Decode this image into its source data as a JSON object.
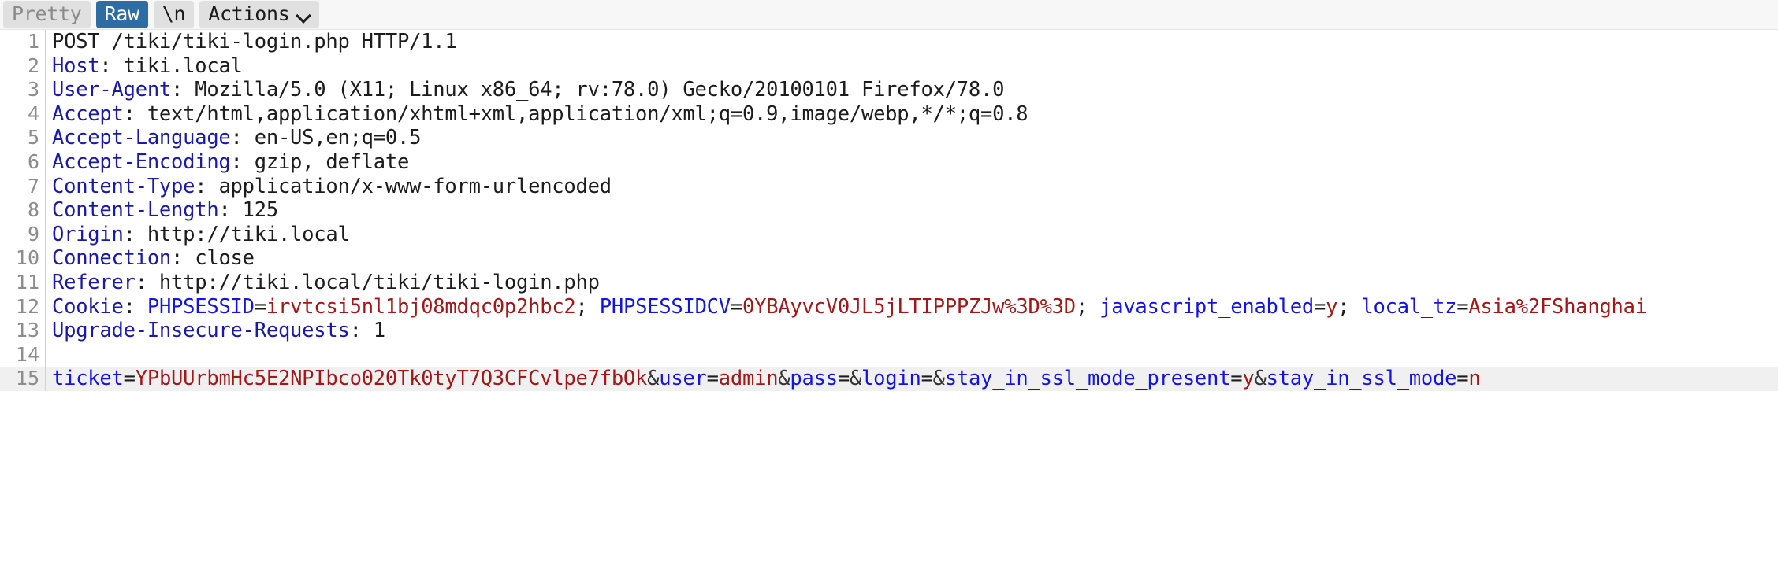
{
  "toolbar": {
    "buttons": [
      {
        "label": "Pretty",
        "state": "inactive"
      },
      {
        "label": "Raw",
        "state": "active"
      },
      {
        "label": "\\n",
        "state": "dark"
      },
      {
        "label": "Actions",
        "state": "dark",
        "icon": "chevron-down-icon"
      }
    ],
    "pretty_label": "Pretty",
    "raw_label": "Raw",
    "newline_label": "\\n",
    "actions_label": "Actions"
  },
  "editor": {
    "highlighted_line": 15,
    "lines": [
      {
        "num": "1",
        "tokens": [
          {
            "t": "POST /tiki/tiki-login.php HTTP/1.1",
            "c": "v"
          }
        ]
      },
      {
        "num": "2",
        "tokens": [
          {
            "t": "Host",
            "c": "k"
          },
          {
            "t": ": tiki.local",
            "c": "v"
          }
        ]
      },
      {
        "num": "3",
        "tokens": [
          {
            "t": "User-Agent",
            "c": "k"
          },
          {
            "t": ": Mozilla/5.0 (X11; Linux x86_64; rv:78.0) Gecko/20100101 Firefox/78.0",
            "c": "v"
          }
        ]
      },
      {
        "num": "4",
        "tokens": [
          {
            "t": "Accept",
            "c": "k"
          },
          {
            "t": ": text/html,application/xhtml+xml,application/xml;q=0.9,image/webp,*/*;q=0.8",
            "c": "v"
          }
        ]
      },
      {
        "num": "5",
        "tokens": [
          {
            "t": "Accept-Language",
            "c": "k"
          },
          {
            "t": ": en-US,en;q=0.5",
            "c": "v"
          }
        ]
      },
      {
        "num": "6",
        "tokens": [
          {
            "t": "Accept-Encoding",
            "c": "k"
          },
          {
            "t": ": gzip, deflate",
            "c": "v"
          }
        ]
      },
      {
        "num": "7",
        "tokens": [
          {
            "t": "Content-Type",
            "c": "k"
          },
          {
            "t": ": application/x-www-form-urlencoded",
            "c": "v"
          }
        ]
      },
      {
        "num": "8",
        "tokens": [
          {
            "t": "Content-Length",
            "c": "k"
          },
          {
            "t": ": 125",
            "c": "v"
          }
        ]
      },
      {
        "num": "9",
        "tokens": [
          {
            "t": "Origin",
            "c": "k"
          },
          {
            "t": ": http://tiki.local",
            "c": "v"
          }
        ]
      },
      {
        "num": "10",
        "tokens": [
          {
            "t": "Connection",
            "c": "k"
          },
          {
            "t": ": close",
            "c": "v"
          }
        ]
      },
      {
        "num": "11",
        "tokens": [
          {
            "t": "Referer",
            "c": "k"
          },
          {
            "t": ": http://tiki.local/tiki/tiki-login.php",
            "c": "v"
          }
        ]
      },
      {
        "num": "12",
        "tokens": [
          {
            "t": "Cookie",
            "c": "k"
          },
          {
            "t": ": ",
            "c": "v"
          },
          {
            "t": "PHPSESSID",
            "c": "kb"
          },
          {
            "t": "=",
            "c": "v"
          },
          {
            "t": "irvtcsi5nl1bj08mdqc0p2hbc2",
            "c": "r"
          },
          {
            "t": "; ",
            "c": "v"
          },
          {
            "t": "PHPSESSIDCV",
            "c": "kb"
          },
          {
            "t": "=",
            "c": "v"
          },
          {
            "t": "0YBAyvcV0JL5jLTIPPPZJw%3D%3D",
            "c": "r"
          },
          {
            "t": "; ",
            "c": "v"
          },
          {
            "t": "javascript_enabled",
            "c": "kb"
          },
          {
            "t": "=",
            "c": "v"
          },
          {
            "t": "y",
            "c": "r"
          },
          {
            "t": "; ",
            "c": "v"
          },
          {
            "t": "local_tz",
            "c": "kb"
          },
          {
            "t": "=",
            "c": "v"
          },
          {
            "t": "Asia%2FShanghai",
            "c": "r"
          }
        ]
      },
      {
        "num": "13",
        "tokens": [
          {
            "t": "Upgrade-Insecure-Requests",
            "c": "k"
          },
          {
            "t": ": 1",
            "c": "v"
          }
        ]
      },
      {
        "num": "14",
        "tokens": []
      },
      {
        "num": "15",
        "highlight": true,
        "tokens": [
          {
            "t": "ticket",
            "c": "kb"
          },
          {
            "t": "=",
            "c": "v"
          },
          {
            "t": "YPbUUrbmHc5E2NPIbco020Tk0tyT7Q3CFCvlpe7fbOk",
            "c": "r"
          },
          {
            "t": "&",
            "c": "amp"
          },
          {
            "t": "user",
            "c": "kb"
          },
          {
            "t": "=",
            "c": "v"
          },
          {
            "t": "admin",
            "c": "r"
          },
          {
            "t": "&",
            "c": "amp"
          },
          {
            "t": "pass",
            "c": "kb"
          },
          {
            "t": "=",
            "c": "v"
          },
          {
            "t": "&",
            "c": "amp"
          },
          {
            "t": "login",
            "c": "kb"
          },
          {
            "t": "=",
            "c": "v"
          },
          {
            "t": "&",
            "c": "amp"
          },
          {
            "t": "stay_in_ssl_mode_present",
            "c": "kb"
          },
          {
            "t": "=",
            "c": "v"
          },
          {
            "t": "y",
            "c": "r"
          },
          {
            "t": "&",
            "c": "amp"
          },
          {
            "t": "stay_in_ssl_mode",
            "c": "kb"
          },
          {
            "t": "=",
            "c": "v"
          },
          {
            "t": "n",
            "c": "r"
          }
        ]
      }
    ]
  },
  "colors": {
    "accent": "#2e6da4",
    "header_name": "#1a1aa8",
    "param_name": "#1414e0",
    "value": "#a01818",
    "text": "#1c1c1c",
    "gutter": "#8d8d8d",
    "highlight_bg": "#f0f0f0",
    "toolbar_bg": "#f7f7f7"
  }
}
